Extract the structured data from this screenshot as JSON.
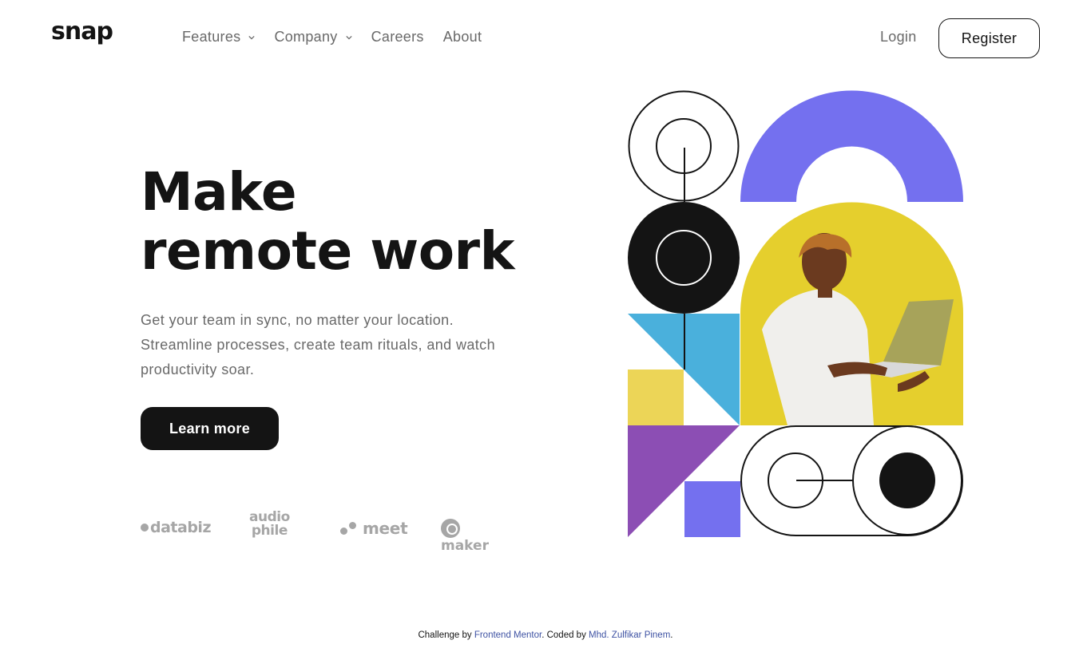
{
  "brand": {
    "logo": "snap"
  },
  "nav": {
    "items": [
      {
        "label": "Features",
        "has_dropdown": true,
        "icon": "chevron-down-icon"
      },
      {
        "label": "Company",
        "has_dropdown": true,
        "icon": "chevron-down-icon"
      },
      {
        "label": "Careers",
        "has_dropdown": false
      },
      {
        "label": "About",
        "has_dropdown": false
      }
    ],
    "login_label": "Login",
    "register_label": "Register"
  },
  "hero": {
    "title_line1": "Make",
    "title_line2": "remote work",
    "description": "Get your team in sync, no matter your location. Streamline processes, create team rituals, and watch productivity soar.",
    "cta_label": "Learn more"
  },
  "clients": {
    "databiz": "databiz",
    "audiophile_top": "audio",
    "audiophile_bottom": "phile",
    "meet": "meet",
    "maker": "maker"
  },
  "illustration": {
    "description": "Geometric collage with man holding laptop on yellow background",
    "colors": {
      "purple_arch": "#7470ef",
      "yellow": "#e5cf2d",
      "blue": "#4ab0dc",
      "yellow_square": "#ecd557",
      "violet": "#8c4eb4",
      "dark": "#141414"
    }
  },
  "footer": {
    "prefix": "Challenge by ",
    "link1": "Frontend Mentor",
    "middle": ". Coded by ",
    "link2": "Mhd. Zulfikar Pinem",
    "suffix": "."
  },
  "colors": {
    "text_dark": "#141414",
    "text_gray": "#696969",
    "link_blue": "#3e52a3",
    "logo_gray": "#a6a6a6"
  }
}
